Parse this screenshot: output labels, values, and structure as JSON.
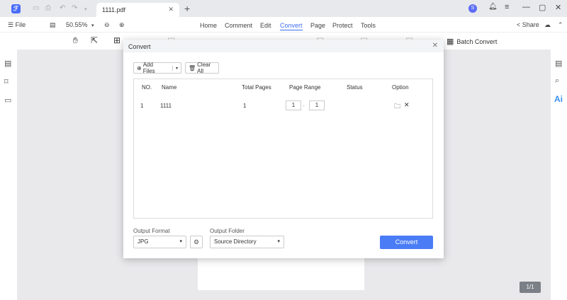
{
  "titlebar": {
    "tab_title": "1111.pdf",
    "avatar_initial": "S"
  },
  "menubar": {
    "file_label": "File",
    "zoom_value": "50.55%",
    "nav_tabs": [
      "Home",
      "Comment",
      "Edit",
      "Convert",
      "Page",
      "Protect",
      "Tools"
    ],
    "share_label": "Share"
  },
  "toolbar": {
    "batch_convert_label": "Batch Convert"
  },
  "right_rail": {
    "ai_label": "Ai"
  },
  "page_counter": "1/1",
  "dialog": {
    "title": "Convert",
    "add_files_label": "Add Files",
    "clear_all_label": "Clear All",
    "table": {
      "headers": [
        "NO.",
        "Name",
        "Total Pages",
        "Page Range",
        "Status",
        "Option"
      ],
      "rows": [
        {
          "no": "1",
          "name": "1111",
          "total_pages": "1",
          "range_from": "1",
          "range_to": "1",
          "status": ""
        }
      ]
    },
    "output_format_label": "Output Format",
    "output_format_value": "JPG",
    "output_folder_label": "Output Folder",
    "output_folder_value": "Source Directory",
    "convert_label": "Convert"
  },
  "colors": {
    "accent": "#3b6cf6",
    "convert_button": "#4a7cf6"
  }
}
